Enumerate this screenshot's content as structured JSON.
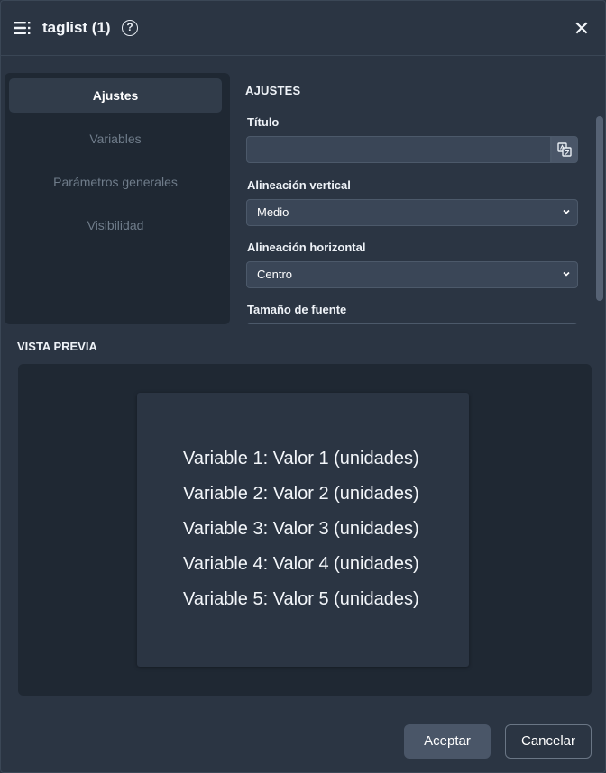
{
  "header": {
    "title": "taglist (1)",
    "help_symbol": "?",
    "close_symbol": "✕"
  },
  "sidenav": {
    "items": [
      {
        "label": "Ajustes",
        "active": true
      },
      {
        "label": "Variables",
        "active": false
      },
      {
        "label": "Parámetros generales",
        "active": false
      },
      {
        "label": "Visibilidad",
        "active": false
      }
    ]
  },
  "settings": {
    "section_title": "AJUSTES",
    "title_field": {
      "label": "Título",
      "value": ""
    },
    "vertical_align": {
      "label": "Alineación vertical",
      "value": "Medio"
    },
    "horizontal_align": {
      "label": "Alineación horizontal",
      "value": "Centro"
    },
    "font_size": {
      "label": "Tamaño de fuente"
    }
  },
  "preview": {
    "title": "VISTA PREVIA",
    "lines": [
      "Variable 1:  Valor 1 (unidades)",
      "Variable 2:  Valor 2 (unidades)",
      "Variable 3:  Valor 3 (unidades)",
      "Variable 4:  Valor 4 (unidades)",
      "Variable 5:  Valor 5 (unidades)"
    ]
  },
  "footer": {
    "accept_label": "Aceptar",
    "cancel_label": "Cancelar"
  },
  "icons": {
    "menu": "menu-icon",
    "help": "help-icon",
    "close": "close-icon",
    "translate": "translate-icon",
    "chevron": "chevron-down-icon"
  },
  "colors": {
    "background": "#2b3543",
    "panel": "#1f2833",
    "input": "#3a4657",
    "button_primary": "#4a5668"
  }
}
